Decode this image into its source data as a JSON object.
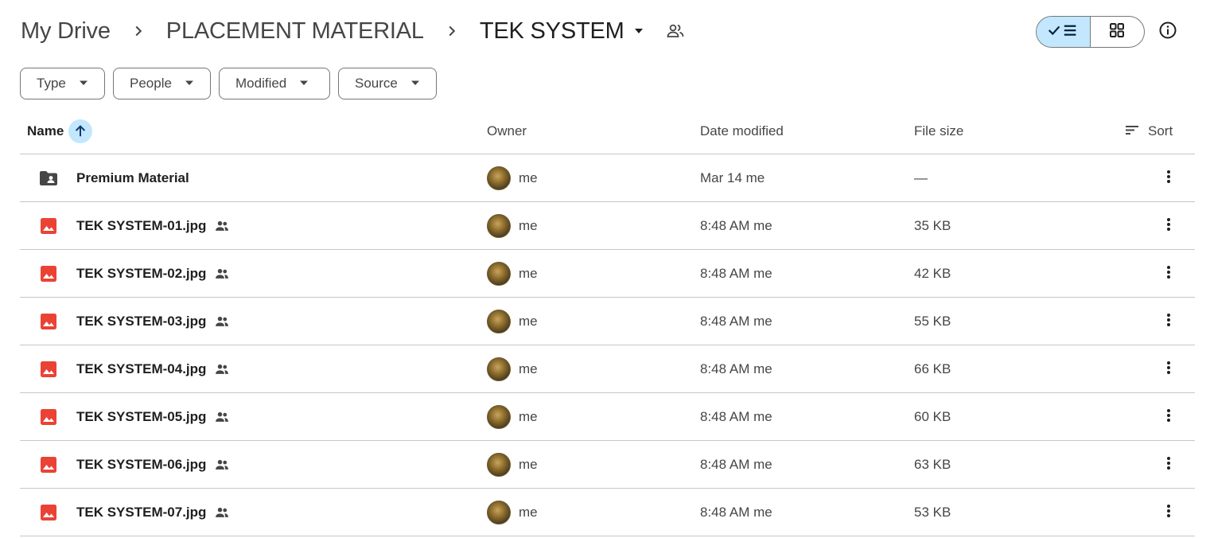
{
  "breadcrumb": {
    "items": [
      "My Drive",
      "PLACEMENT MATERIAL",
      "TEK SYSTEM"
    ]
  },
  "filters": [
    "Type",
    "People",
    "Modified",
    "Source"
  ],
  "columns": {
    "name": "Name",
    "owner": "Owner",
    "date": "Date modified",
    "size": "File size",
    "sort": "Sort"
  },
  "rows": [
    {
      "name": "Premium Material",
      "kind": "shared-folder",
      "shared": false,
      "owner": "me",
      "date": "Mar 14 me",
      "size": "—"
    },
    {
      "name": "TEK SYSTEM-01.jpg",
      "kind": "image",
      "shared": true,
      "owner": "me",
      "date": "8:48 AM me",
      "size": "35 KB"
    },
    {
      "name": "TEK SYSTEM-02.jpg",
      "kind": "image",
      "shared": true,
      "owner": "me",
      "date": "8:48 AM me",
      "size": "42 KB"
    },
    {
      "name": "TEK SYSTEM-03.jpg",
      "kind": "image",
      "shared": true,
      "owner": "me",
      "date": "8:48 AM me",
      "size": "55 KB"
    },
    {
      "name": "TEK SYSTEM-04.jpg",
      "kind": "image",
      "shared": true,
      "owner": "me",
      "date": "8:48 AM me",
      "size": "66 KB"
    },
    {
      "name": "TEK SYSTEM-05.jpg",
      "kind": "image",
      "shared": true,
      "owner": "me",
      "date": "8:48 AM me",
      "size": "60 KB"
    },
    {
      "name": "TEK SYSTEM-06.jpg",
      "kind": "image",
      "shared": true,
      "owner": "me",
      "date": "8:48 AM me",
      "size": "63 KB"
    },
    {
      "name": "TEK SYSTEM-07.jpg",
      "kind": "image",
      "shared": true,
      "owner": "me",
      "date": "8:48 AM me",
      "size": "53 KB"
    }
  ],
  "colors": {
    "accent_light": "#c2e7ff",
    "image_icon": "#ea4335",
    "folder_icon": "#444746",
    "divider": "#c7c7c7"
  },
  "icons": {
    "view_list": "check-list-icon",
    "view_grid": "grid-icon",
    "info": "info-icon"
  }
}
